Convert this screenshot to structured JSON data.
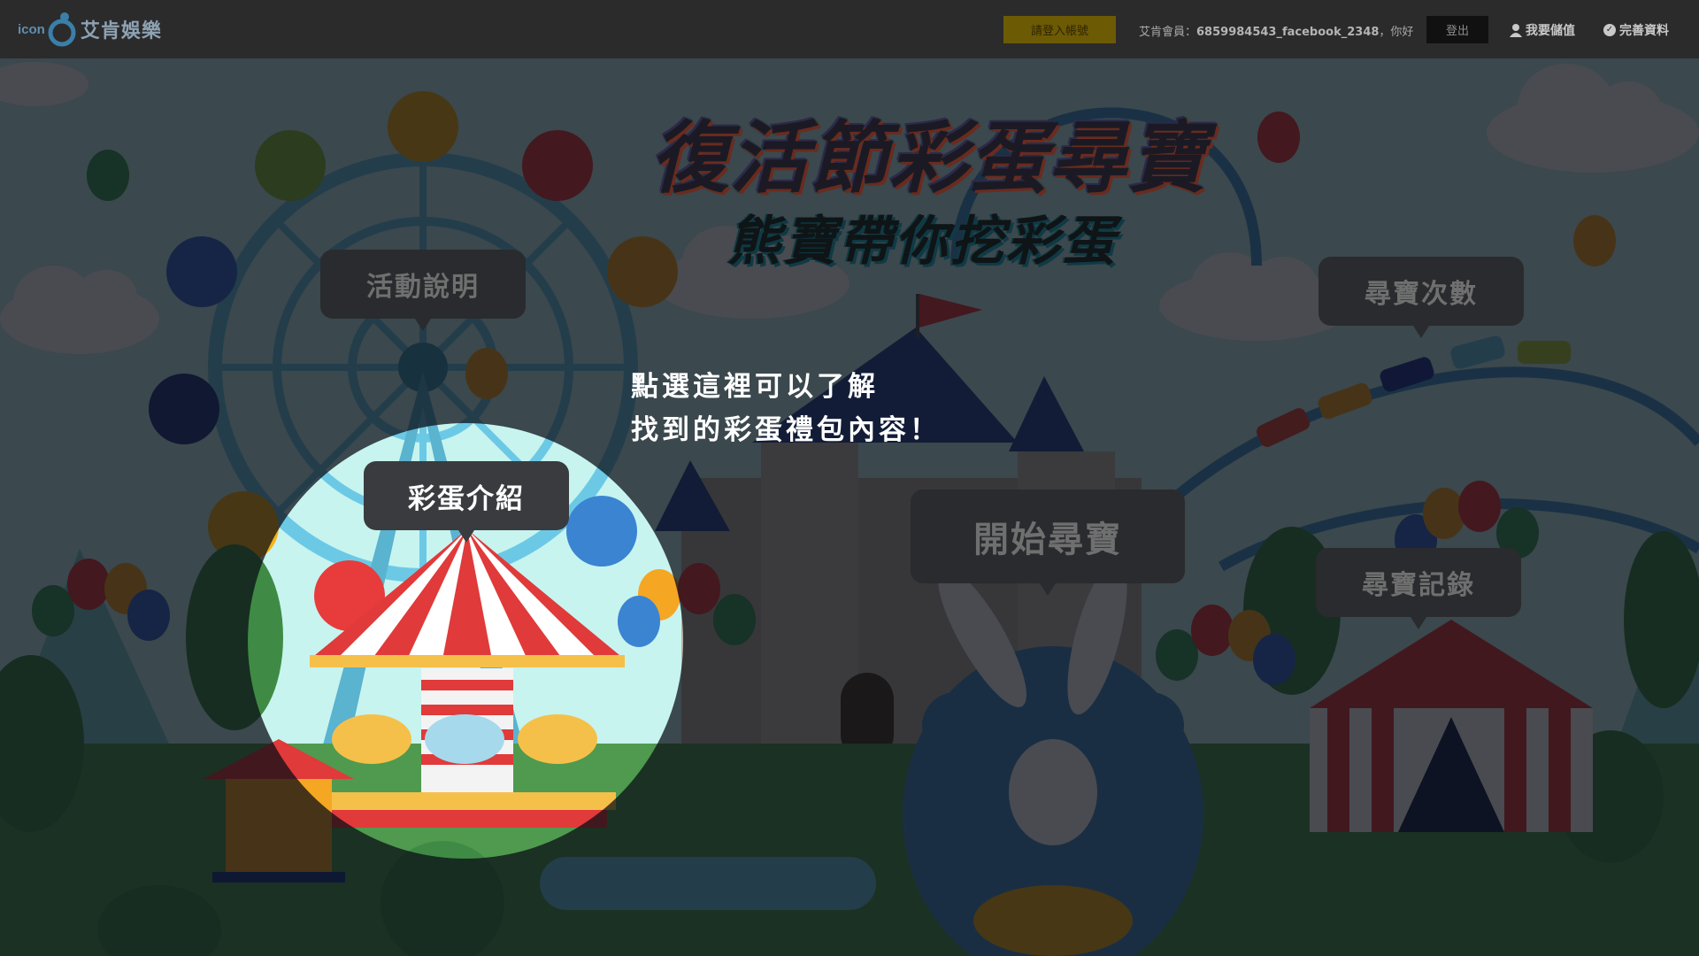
{
  "header": {
    "logo_small": "icon",
    "logo_text": "艾肯娛樂",
    "login_label": "請登入帳號",
    "member_prefix": "艾肯會員：",
    "member_id": "6859984543_facebook_2348",
    "member_suffix": "，你好",
    "logout_label": "登出",
    "topup_label": "我要儲值",
    "profile_label": "完善資料"
  },
  "event": {
    "title": "復活節彩蛋尋寶",
    "subtitle": "熊寶帶你挖彩蛋"
  },
  "menu": {
    "rules": "活動說明",
    "egg_intro": "彩蛋介紹",
    "start": "開始尋寶",
    "count": "尋寶次數",
    "records": "尋寶記錄"
  },
  "tutorial": {
    "line1": "點選這裡可以了解",
    "line2": "找到的彩蛋禮包內容！"
  },
  "colors": {
    "login_button": "#f5c400",
    "overlay": "rgba(10,12,20,0.72)",
    "sky": "#c7f4ef",
    "grass": "#4f9a4e"
  }
}
